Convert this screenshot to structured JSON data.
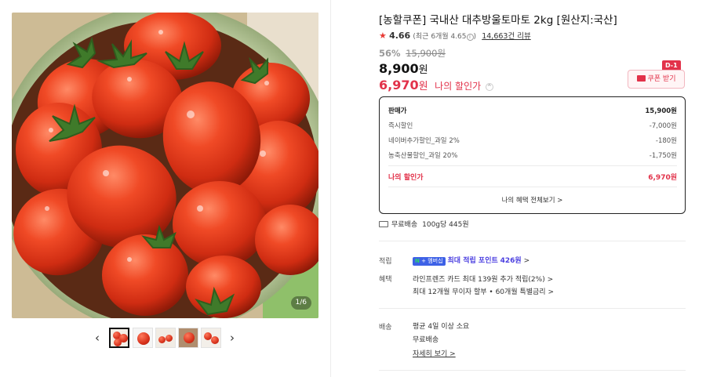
{
  "gallery": {
    "counter": "1/6",
    "prev_icon": "chevron-left-icon",
    "next_icon": "chevron-right-icon",
    "prev_glyph": "‹",
    "next_glyph": "›",
    "thumbnail_count": 5,
    "active_thumbnail": 1
  },
  "product": {
    "title": "[농할쿠폰] 국내산 대추방울토마토 2kg [원산지:국산]",
    "rating_score": "4.66",
    "rating_sub": "(최근 6개월 4.65",
    "rating_info": "i",
    "rating_close": ")",
    "review_count": "14,663건 리뷰",
    "discount_rate": "56%",
    "original_price": "15,900원",
    "sale_price": "8,900",
    "sale_unit": "원",
    "my_price": "6,970",
    "my_price_unit": "원",
    "my_price_label": "나의 할인가",
    "my_price_chevron": "^",
    "coupon_label": "쿠폰 받기",
    "coupon_badge": "D-1"
  },
  "price_box": {
    "rows": [
      {
        "label": "판매가",
        "value": "15,900원"
      },
      {
        "label": "즉시할인",
        "value": "-7,000원"
      },
      {
        "label": "네이버추가할인_과일 2%",
        "value": "-180원"
      },
      {
        "label": "농축산물할인_과일 20%",
        "value": "-1,750원"
      }
    ],
    "total_label": "나의 할인가",
    "total_value": "6,970원",
    "benefits_link": "나의 혜택 전체보기 >"
  },
  "shipping": {
    "free_label": "무료배송",
    "unit_price": "100g당 445원"
  },
  "points": {
    "label": "적립",
    "badge_n": "N",
    "badge_plus": "+",
    "badge_text": "멤버십",
    "text": "최대 적립 포인트",
    "value": "426원",
    "chevron": ">"
  },
  "benefits": {
    "label": "혜택",
    "line1": "라인프렌즈 카드 최대 139원 추가 적립(2%) >",
    "line2": "최대 12개월 무이자 할부 • 60개월 특별금리 >"
  },
  "delivery": {
    "label": "배송",
    "line1": "평균 4일 이상 소요",
    "line2": "무료배송",
    "details_link": "자세히 보기 >"
  },
  "colors": {
    "accent_red": "#e2324a",
    "star": "#e83a34",
    "points_purple": "#4b3fe0",
    "npay_blue": "#3d61e6"
  }
}
